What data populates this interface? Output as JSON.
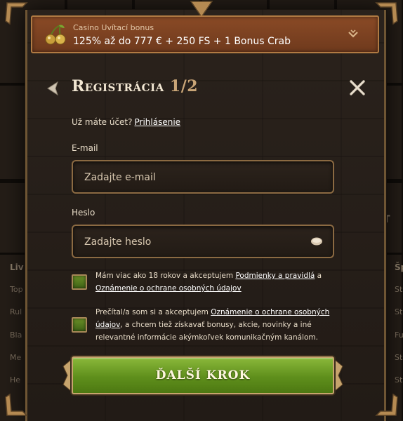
{
  "background": {
    "left_labels": [
      "Liv",
      "Top",
      "Rul",
      "Bla",
      "Me",
      "He"
    ],
    "right_labels": [
      "Šp",
      "St",
      "St",
      "Fu",
      "St",
      "St"
    ],
    "right_mid_glyph": "T"
  },
  "bonus": {
    "title": "Casino Uvítací bonus",
    "text": "125% až do 777 € + 250 FS + 1 Bonus Crab",
    "icon": "cherry-icon",
    "toggle_icon": "chevron-down-icon"
  },
  "header": {
    "title_main": "Registrácia ",
    "title_step": "1/2",
    "back_icon": "arrow-left-icon",
    "close_icon": "close-icon"
  },
  "login": {
    "prompt": "Už máte účet?",
    "link": "Prihlásenie"
  },
  "email": {
    "label": "E-mail",
    "placeholder": "Zadajte e-mail",
    "value": ""
  },
  "password": {
    "label": "Heslo",
    "placeholder": "Zadajte heslo",
    "value": "",
    "toggle_icon": "eye-icon"
  },
  "consent_age": {
    "text_before": "Mám viac ako 18 rokov a akceptujem ",
    "link1": "Podmienky a pravidlá",
    "text_middle": " a ",
    "link2": "Oznámenie o ochrane osobných údajov",
    "checked": true
  },
  "consent_marketing": {
    "text_before": "Prečítal/a som si a akceptujem ",
    "link": "Oznámenie o ochrane osobných údajov",
    "text_after": ", a chcem tiež získavať bonusy, akcie, novinky a iné relevantné informácie akýmkoľvek komunikačným kanálom.",
    "checked": true
  },
  "next_button": {
    "label": "ĎALŠÍ KROK"
  },
  "colors": {
    "accent_green": "#5f8f1c",
    "gold_border": "#c7a46d",
    "banner_brown": "#7a4121"
  }
}
